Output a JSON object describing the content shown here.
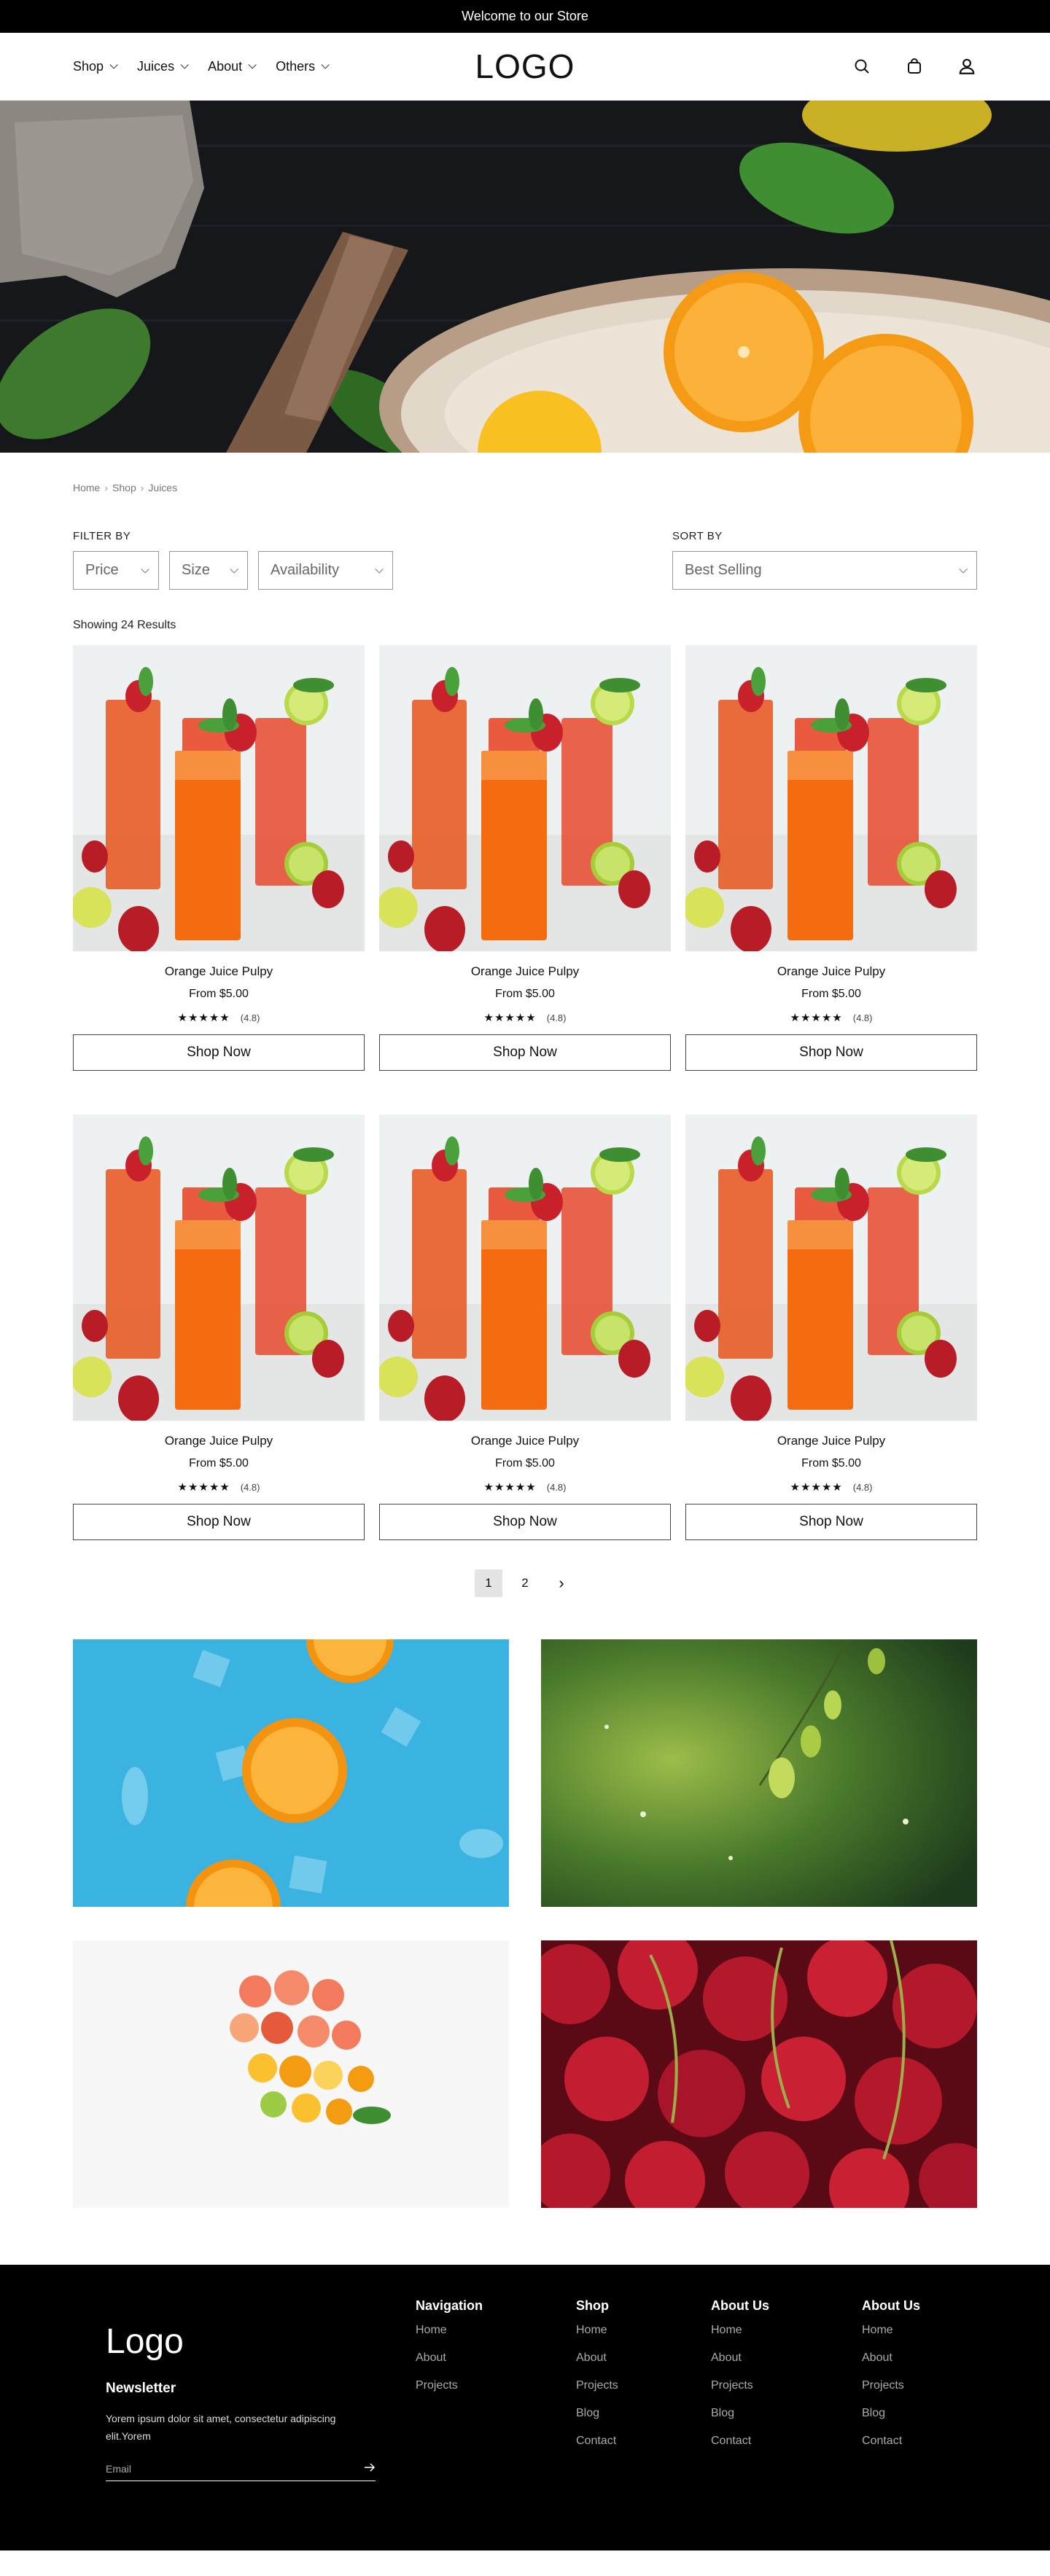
{
  "announcement": "Welcome to our Store",
  "header": {
    "logo": "LOGO",
    "nav": [
      {
        "label": "Shop"
      },
      {
        "label": "Juices"
      },
      {
        "label": "About"
      },
      {
        "label": "Others"
      }
    ],
    "icons": [
      "search-icon",
      "bag-icon",
      "user-icon"
    ]
  },
  "breadcrumb": [
    "Home",
    "Shop",
    "Juices"
  ],
  "filters": {
    "label": "FILTER BY",
    "price": "Price",
    "size": "Size",
    "availability": "Availability"
  },
  "sort": {
    "label": "SORT BY",
    "value": "Best Selling"
  },
  "results_text": "Showing 24 Results",
  "products": [
    {
      "name": "Orange Juice Pulpy",
      "price": "From $5.00",
      "stars": "★★★★★",
      "rating": "(4.8)",
      "button": "Shop Now"
    },
    {
      "name": "Orange Juice Pulpy",
      "price": "From $5.00",
      "stars": "★★★★★",
      "rating": "(4.8)",
      "button": "Shop Now"
    },
    {
      "name": "Orange Juice Pulpy",
      "price": "From $5.00",
      "stars": "★★★★★",
      "rating": "(4.8)",
      "button": "Shop Now"
    },
    {
      "name": "Orange Juice Pulpy",
      "price": "From $5.00",
      "stars": "★★★★★",
      "rating": "(4.8)",
      "button": "Shop Now"
    },
    {
      "name": "Orange Juice Pulpy",
      "price": "From $5.00",
      "stars": "★★★★★",
      "rating": "(4.8)",
      "button": "Shop Now"
    },
    {
      "name": "Orange Juice Pulpy",
      "price": "From $5.00",
      "stars": "★★★★★",
      "rating": "(4.8)",
      "button": "Shop Now"
    }
  ],
  "pagination": {
    "pages": [
      "1",
      "2"
    ],
    "current": "1",
    "next": "›"
  },
  "footer": {
    "logo": "Logo",
    "newsletter_title": "Newsletter",
    "newsletter_desc": "Yorem ipsum dolor sit amet, consectetur adipiscing elit.Yorem",
    "email_placeholder": "Email",
    "columns": [
      {
        "title": "Navigation",
        "links": [
          "Home",
          "About",
          "Projects"
        ]
      },
      {
        "title": "Shop",
        "links": [
          "Home",
          "About",
          "Projects",
          "Blog",
          "Contact"
        ]
      },
      {
        "title": "About Us",
        "links": [
          "Home",
          "About",
          "Projects",
          "Blog",
          "Contact"
        ]
      },
      {
        "title": "About Us",
        "links": [
          "Home",
          "About",
          "Projects",
          "Blog",
          "Contact"
        ]
      }
    ]
  },
  "colors": {
    "announcement_bg": "#000000",
    "footer_bg": "#000000",
    "gallery_blue": "#3bb3e0",
    "juice_orange": "#f06a1f"
  }
}
